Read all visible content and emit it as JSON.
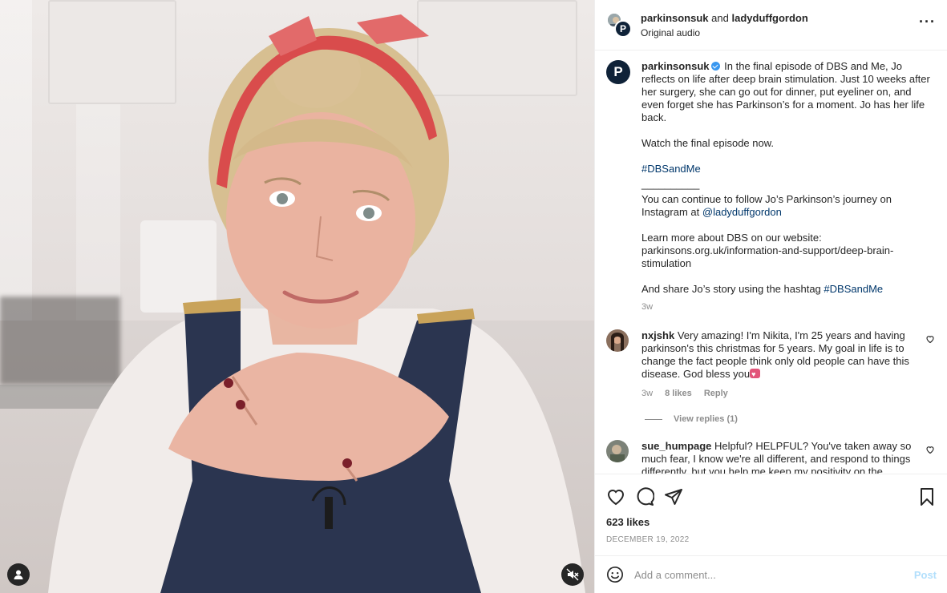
{
  "header": {
    "user1": "parkinsonsuk",
    "and": "and",
    "user2": "ladyduffgordon",
    "audio": "Original audio",
    "more_icon": "more-horizontal-icon"
  },
  "post": {
    "avatar_letter": "P",
    "username": "parkinsonsuk",
    "paragraph1": "In the final episode of DBS and Me, Jo reflects on life after deep brain stimulation. Just 10 weeks after her surgery, she can go out for dinner, put eyeliner on, and even forget she has Parkinson’s for a moment. Jo has her life back.",
    "paragraph2": "Watch the final episode now.",
    "hashtag1": "#DBSandMe",
    "divider": "__________",
    "paragraph3_prefix": "You can continue to follow Jo’s Parkinson’s journey on Instagram at",
    "mention": "@ladyduffgordon",
    "paragraph4": "Learn more about DBS on our website: parkinsons.org.uk/information-and-support/deep-brain-stimulation",
    "paragraph5_prefix": "And share Jo’s story using the hashtag",
    "hashtag2": "#DBSandMe",
    "time": "3w"
  },
  "comments": [
    {
      "username": "nxjshk",
      "text": "Very amazing! I'm Nikita, I'm 25 years and having parkinson's this christmas for 5 years. My goal in life is to change the fact people think only old people can have this disease. God bless you",
      "time": "3w",
      "likes": "8 likes",
      "reply": "Reply",
      "view_replies": "View replies (1)"
    },
    {
      "username": "sue_humpage",
      "text": "Helpful? HELPFUL? You've taken away so much fear, I know we're all different, and respond to things differently, but you help me keep my positivity on the"
    }
  ],
  "actions": {
    "likes": "623 likes",
    "date": "DECEMBER 19, 2022"
  },
  "comment_box": {
    "placeholder": "Add a comment...",
    "post": "Post"
  },
  "colors": {
    "link": "#00376b",
    "verified": "#3897f0",
    "post_button_disabled": "#b2dffc",
    "brand_navy": "#0f2238"
  }
}
